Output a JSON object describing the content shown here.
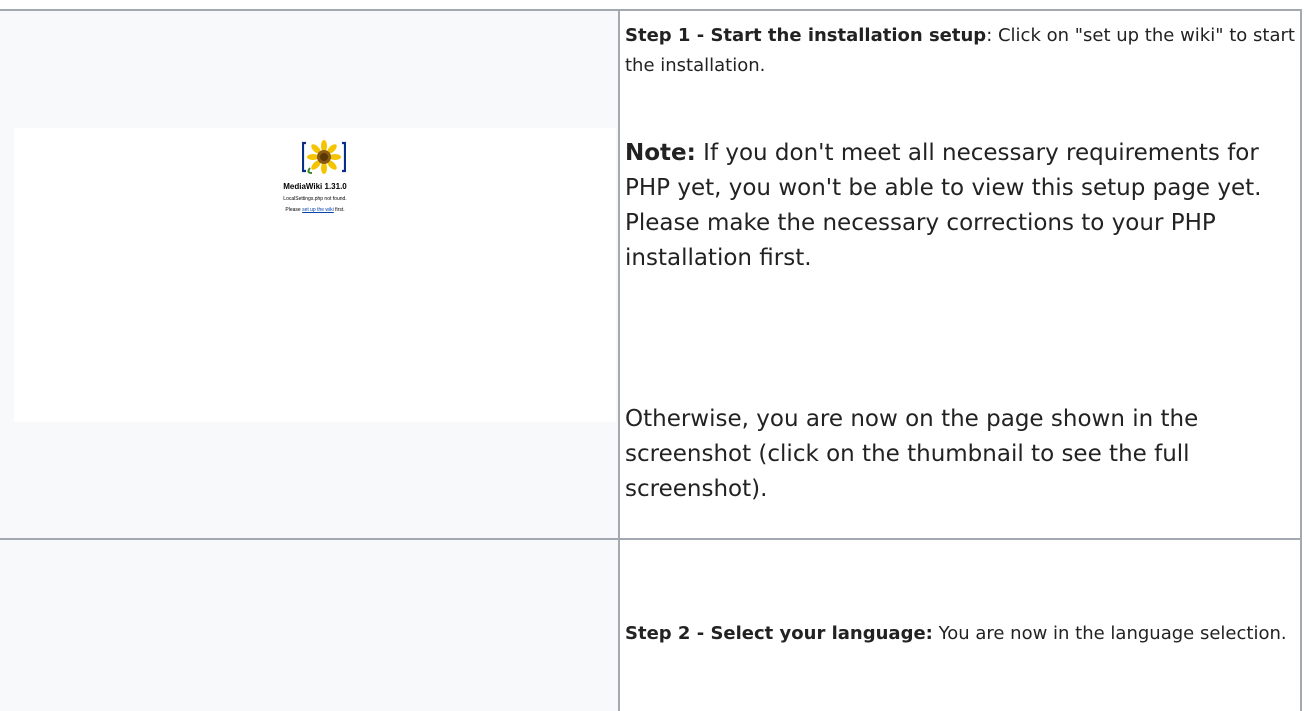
{
  "row1": {
    "thumbnail": {
      "title": "MediaWiki 1.31.0",
      "line1": "LocalSettings.php not found.",
      "line2_prefix": "Please ",
      "line2_link": "set up the wiki",
      "line2_suffix": " first."
    },
    "step_heading": "Step 1 - Start the installation setup",
    "step_text": ": Click on \"set up the wiki\" to start the installation.",
    "note_label": "Note:",
    "note_text": " If you don't meet all necessary requirements for PHP yet, you won't be able to view this setup page yet. Please make the necessary corrections to your PHP installation first.",
    "otherwise_text": "Otherwise, you are now on the page shown in the screenshot (click on the thumbnail to see the full screenshot)."
  },
  "row2": {
    "step_heading": "Step 2 - Select your language:",
    "step_text": " You are now in the language selection."
  }
}
